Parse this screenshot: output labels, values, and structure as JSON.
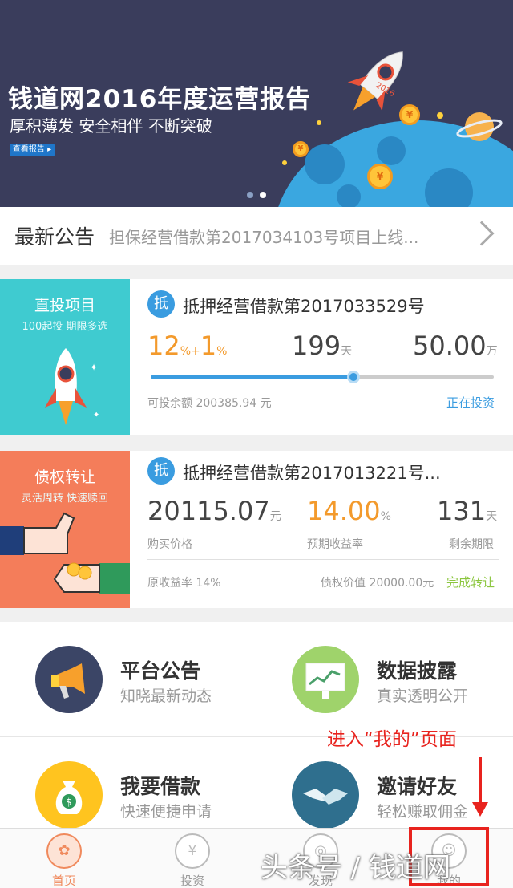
{
  "banner": {
    "title": "钱道网2016年度运营报告",
    "subtitle": "厚积薄发  安全相伴  不断突破",
    "button_label": "查看报告 ▸",
    "rocket_label": "2016",
    "coin_symbol": "¥",
    "page_count": 2,
    "active_page": 1
  },
  "notice": {
    "label": "最新公告",
    "text": "担保经营借款第2017034103号项目上线..."
  },
  "card1": {
    "image_title": "直投项目",
    "image_sub": "100起投  期限多选",
    "badge": "抵",
    "title": "抵押经营借款第2017033529号",
    "rate": "12",
    "rate_unit": "%+",
    "rate_bonus": "1",
    "rate_bonus_unit": "%",
    "days": "199",
    "days_unit": "天",
    "amount": "50.00",
    "amount_unit": "万",
    "progress": 0.59,
    "remaining": "可投余额 200385.94 元",
    "status": "正在投资"
  },
  "card2": {
    "image_title": "债权转让",
    "image_sub": "灵活周转  快速赎回",
    "badge": "抵",
    "title": "抵押经营借款第2017013221号...",
    "price": "20115.07",
    "price_unit": "元",
    "price_label": "购买价格",
    "rate": "14.00",
    "rate_unit": "%",
    "rate_label": "预期收益率",
    "days": "131",
    "days_unit": "天",
    "days_label": "剩余期限",
    "orig_rate": "原收益率 14%",
    "value": "债权价值 20000.00元",
    "status": "完成转让"
  },
  "grid": [
    {
      "title": "平台公告",
      "sub": "知晓最新动态",
      "icon": "megaphone-icon",
      "color": "#3b4566"
    },
    {
      "title": "数据披露",
      "sub": "真实透明公开",
      "icon": "chart-board-icon",
      "color": "#9fd36b"
    },
    {
      "title": "我要借款",
      "sub": "快速便捷申请",
      "icon": "money-bag-icon",
      "color": "#ffc41f"
    },
    {
      "title": "邀请好友",
      "sub": "轻松赚取佣金",
      "icon": "handshake-icon",
      "color": "#2f6f8e"
    }
  ],
  "tabs": [
    {
      "label": "首页",
      "icon": "home-tree-icon",
      "glyph": "✿",
      "active": true
    },
    {
      "label": "投资",
      "icon": "yen-icon",
      "glyph": "¥",
      "active": false
    },
    {
      "label": "发现",
      "icon": "discover-icon",
      "glyph": "◎",
      "active": false
    },
    {
      "label": "我的",
      "icon": "user-icon",
      "glyph": "☺",
      "active": false
    }
  ],
  "annotation": {
    "text": "进入“我的”页面"
  },
  "watermark": "头条号 / 钱道网"
}
